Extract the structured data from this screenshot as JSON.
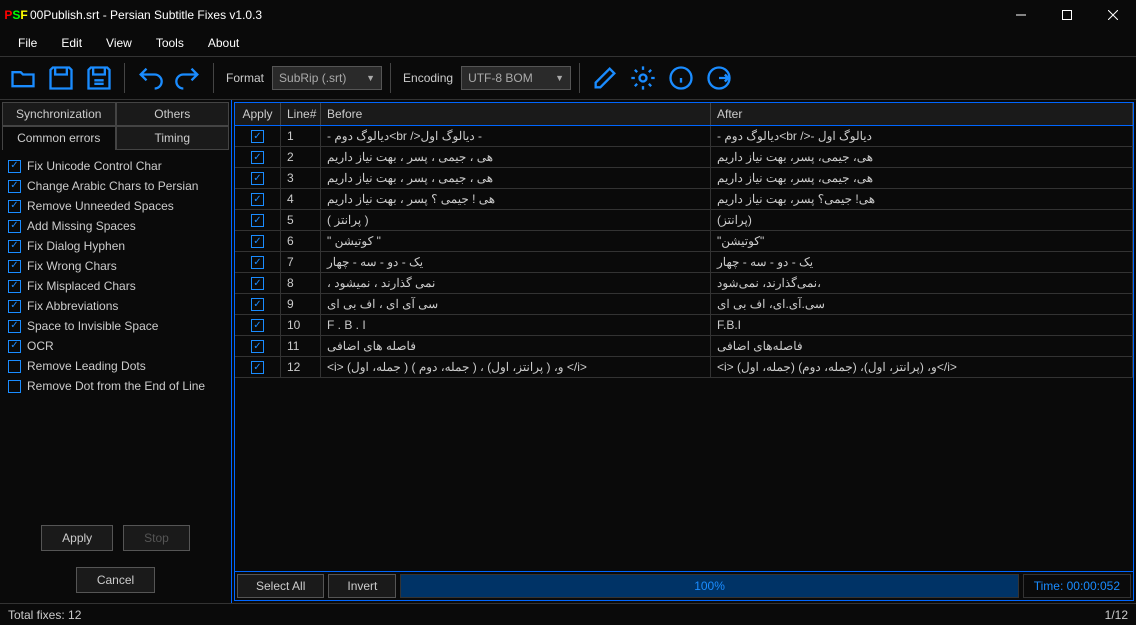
{
  "window": {
    "title": "00Publish.srt - Persian Subtitle Fixes v1.0.3"
  },
  "menu": {
    "file": "File",
    "edit": "Edit",
    "view": "View",
    "tools": "Tools",
    "about": "About"
  },
  "toolbar": {
    "format_label": "Format",
    "format_value": "SubRip (.srt)",
    "encoding_label": "Encoding",
    "encoding_value": "UTF-8 BOM"
  },
  "sidebar": {
    "tabs": {
      "sync": "Synchronization",
      "others": "Others",
      "common": "Common errors",
      "timing": "Timing"
    },
    "checks": [
      {
        "label": "Fix Unicode Control Char",
        "on": true
      },
      {
        "label": "Change Arabic Chars to Persian",
        "on": true
      },
      {
        "label": "Remove Unneeded Spaces",
        "on": true
      },
      {
        "label": "Add Missing Spaces",
        "on": true
      },
      {
        "label": "Fix Dialog Hyphen",
        "on": true
      },
      {
        "label": "Fix Wrong Chars",
        "on": true
      },
      {
        "label": "Fix Misplaced Chars",
        "on": true
      },
      {
        "label": "Fix Abbreviations",
        "on": true
      },
      {
        "label": "Space to Invisible Space",
        "on": true
      },
      {
        "label": "OCR",
        "on": true
      },
      {
        "label": "Remove Leading Dots",
        "on": false
      },
      {
        "label": "Remove Dot from the End of Line",
        "on": false
      }
    ],
    "apply": "Apply",
    "stop": "Stop",
    "cancel": "Cancel"
  },
  "table": {
    "headers": {
      "apply": "Apply",
      "line": "Line#",
      "before": "Before",
      "after": "After"
    },
    "rows": [
      {
        "n": "1",
        "before": "- دیالوگ دوم<br />دیالوگ اول -",
        "after": "- دیالوگ دوم<br />- دیالوگ اول"
      },
      {
        "n": "2",
        "before": "هی ، جیمی ، پسر ، بهت نیاز داریم",
        "after": "هی، جیمی، پسر، بهت نیاز داریم"
      },
      {
        "n": "3",
        "before": "هی ، جیمی ، پسر ، بهت نیاز داریم",
        "after": "هی، جیمی، پسر، بهت نیاز داریم"
      },
      {
        "n": "4",
        "before": "هی ! جیمی ؟ پسر ، بهت نیاز داریم",
        "after": "هی! جیمی؟ پسر، بهت نیاز داریم"
      },
      {
        "n": "5",
        "before": "( پرانتز )",
        "after": "(پرانتز)"
      },
      {
        "n": "6",
        "before": "\" کوتیشن \"",
        "after": "\"کوتیشن\""
      },
      {
        "n": "7",
        "before": "یک - دو -  سه  - چهار",
        "after": "یک - دو - سه - چهار"
      },
      {
        "n": "8",
        "before": "، نمی گذارند ، نمیشود",
        "after": "نمی‌گذارند، نمی‌شود،"
      },
      {
        "n": "9",
        "before": "سی آی ای ، اف بی ای",
        "after": "سی.آی.ای، اف بی ای"
      },
      {
        "n": "10",
        "before": "F . B . I",
        "after": "F.B.I"
      },
      {
        "n": "11",
        "before": "فاصله های     اضافی",
        "after": "فاصله‌های اضافی"
      },
      {
        "n": "12",
        "before": "<i> (جمله، اول ) و، ( پرانتز، اول) ، ( جمله، دوم ) </i>",
        "after": "<i> (جمله، اول) و، (پرانتز، اول)، (جمله، دوم)</i>"
      }
    ],
    "select_all": "Select All",
    "invert": "Invert",
    "progress": "100%",
    "time": "Time: 00:00:052"
  },
  "status": {
    "left": "Total fixes: 12",
    "right": "1/12"
  }
}
